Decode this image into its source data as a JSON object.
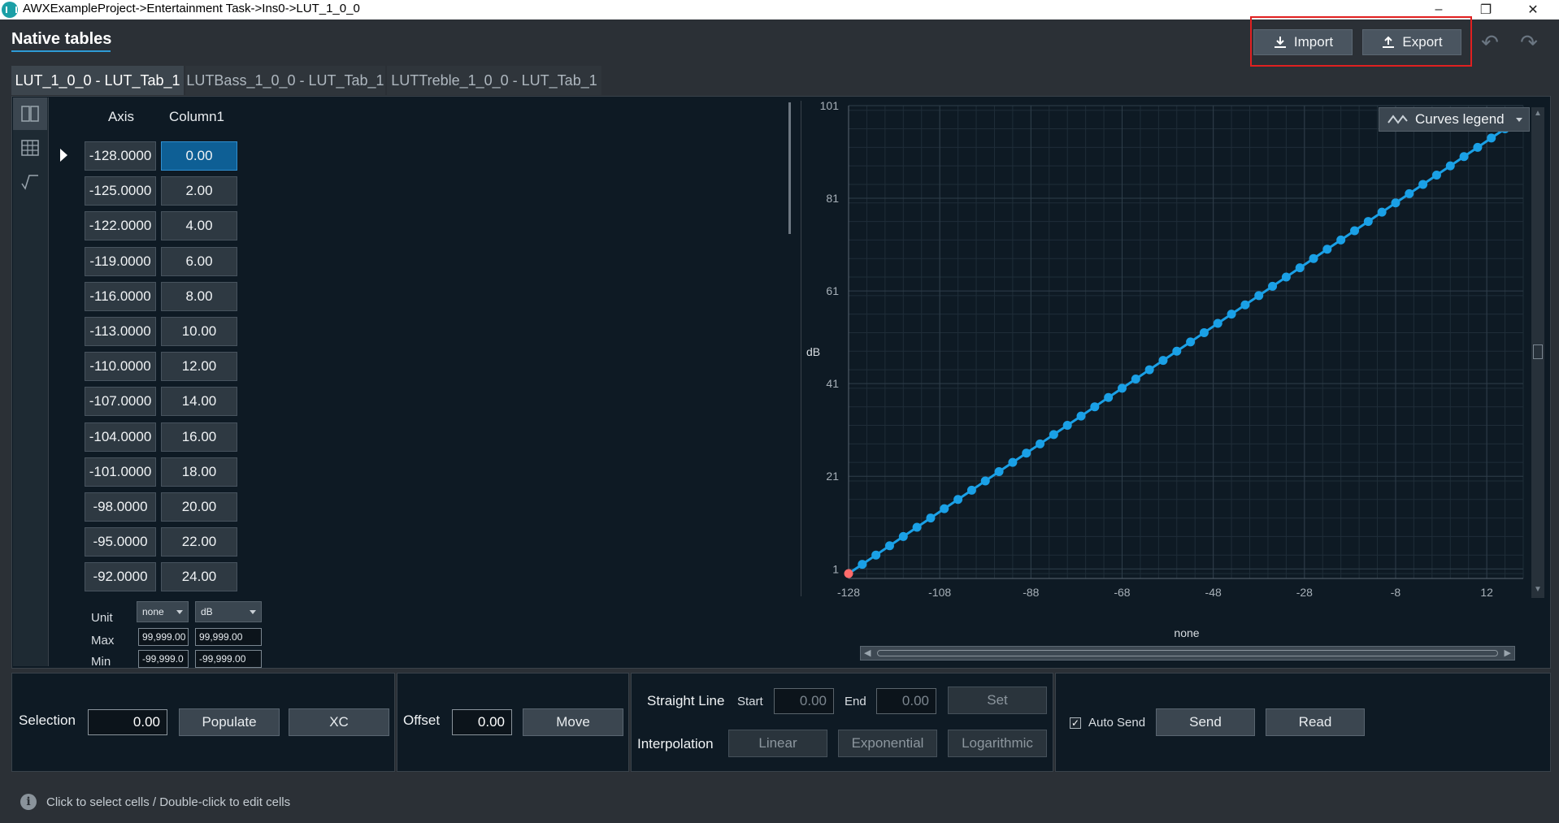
{
  "window": {
    "title": "AWXExampleProject->Entertainment Task->Ins0->LUT_1_0_0"
  },
  "header": {
    "title": "Native tables",
    "import_label": "Import",
    "export_label": "Export"
  },
  "tabs": [
    {
      "label": "LUT_1_0_0 - LUT_Tab_1",
      "active": true
    },
    {
      "label": "LUTBass_1_0_0 - LUT_Tab_1",
      "active": false
    },
    {
      "label": "LUTTreble_1_0_0 - LUT_Tab_1",
      "active": false
    }
  ],
  "sidebar_tools": [
    "split-view-icon",
    "grid-icon",
    "curve-icon"
  ],
  "table": {
    "headers": [
      "Axis",
      "Column1"
    ],
    "rows": [
      [
        "-128.0000",
        "0.00"
      ],
      [
        "-125.0000",
        "2.00"
      ],
      [
        "-122.0000",
        "4.00"
      ],
      [
        "-119.0000",
        "6.00"
      ],
      [
        "-116.0000",
        "8.00"
      ],
      [
        "-113.0000",
        "10.00"
      ],
      [
        "-110.0000",
        "12.00"
      ],
      [
        "-107.0000",
        "14.00"
      ],
      [
        "-104.0000",
        "16.00"
      ],
      [
        "-101.0000",
        "18.00"
      ],
      [
        "-98.0000",
        "20.00"
      ],
      [
        "-95.0000",
        "22.00"
      ],
      [
        "-92.0000",
        "24.00"
      ]
    ],
    "selected_row": 0
  },
  "meta": {
    "unit_label": "Unit",
    "max_label": "Max",
    "min_label": "Min",
    "axis_unit": "none",
    "col_unit": "dB",
    "axis_max": "99,999.00",
    "col_max": "99,999.00",
    "axis_min": "-99,999.0",
    "col_min": "-99,999.00"
  },
  "chart": {
    "legend_button": "Curves legend",
    "ylabel": "dB",
    "xlabel": "none",
    "yticks": [
      "101",
      "81",
      "61",
      "41",
      "21",
      "1"
    ],
    "xticks": [
      "-128",
      "-108",
      "-88",
      "-68",
      "-48",
      "-28",
      "-8",
      "12"
    ],
    "series_color": "#1aa0e6",
    "selected_point_color": "#ff6b6b"
  },
  "chart_data": {
    "type": "line",
    "xlabel": "none",
    "ylabel": "dB",
    "xlim": [
      -128,
      20
    ],
    "ylim": [
      0,
      101
    ],
    "grid": true,
    "legend": "top-right",
    "series": [
      {
        "x": [
          -128,
          -125,
          -122,
          -119,
          -116,
          -113,
          -110,
          -107,
          -104,
          -101,
          -98,
          -95,
          -92,
          -89,
          -86,
          -83,
          -80,
          -77,
          -74,
          -71,
          -68,
          -65,
          -62,
          -59,
          -56,
          -53,
          -50,
          -47,
          -44,
          -41,
          -38,
          -35,
          -32,
          -29,
          -26,
          -23,
          -20,
          -17,
          -14,
          -11,
          -8,
          -5,
          -2,
          1,
          4,
          7,
          10,
          13,
          16
        ],
        "values": [
          0,
          2,
          4,
          6,
          8,
          10,
          12,
          14,
          16,
          18,
          20,
          22,
          24,
          26,
          28,
          30,
          32,
          34,
          36,
          38,
          40,
          42,
          44,
          46,
          48,
          50,
          52,
          54,
          56,
          58,
          60,
          62,
          64,
          66,
          68,
          70,
          72,
          74,
          76,
          78,
          80,
          82,
          84,
          86,
          88,
          90,
          92,
          94,
          96
        ]
      }
    ]
  },
  "controls": {
    "selection_label": "Selection",
    "selection_value": "0.00",
    "populate_label": "Populate",
    "xc_label": "XC",
    "offset_label": "Offset",
    "offset_value": "0.00",
    "move_label": "Move",
    "straight_line_label": "Straight Line",
    "start_label": "Start",
    "start_value": "0.00",
    "end_label": "End",
    "end_value": "0.00",
    "set_label": "Set",
    "interpolation_label": "Interpolation",
    "linear_label": "Linear",
    "exponential_label": "Exponential",
    "logarithmic_label": "Logarithmic",
    "auto_send_label": "Auto Send",
    "auto_send_checked": true,
    "send_label": "Send",
    "read_label": "Read"
  },
  "status": {
    "text": "Click to select cells / Double-click to edit cells"
  }
}
